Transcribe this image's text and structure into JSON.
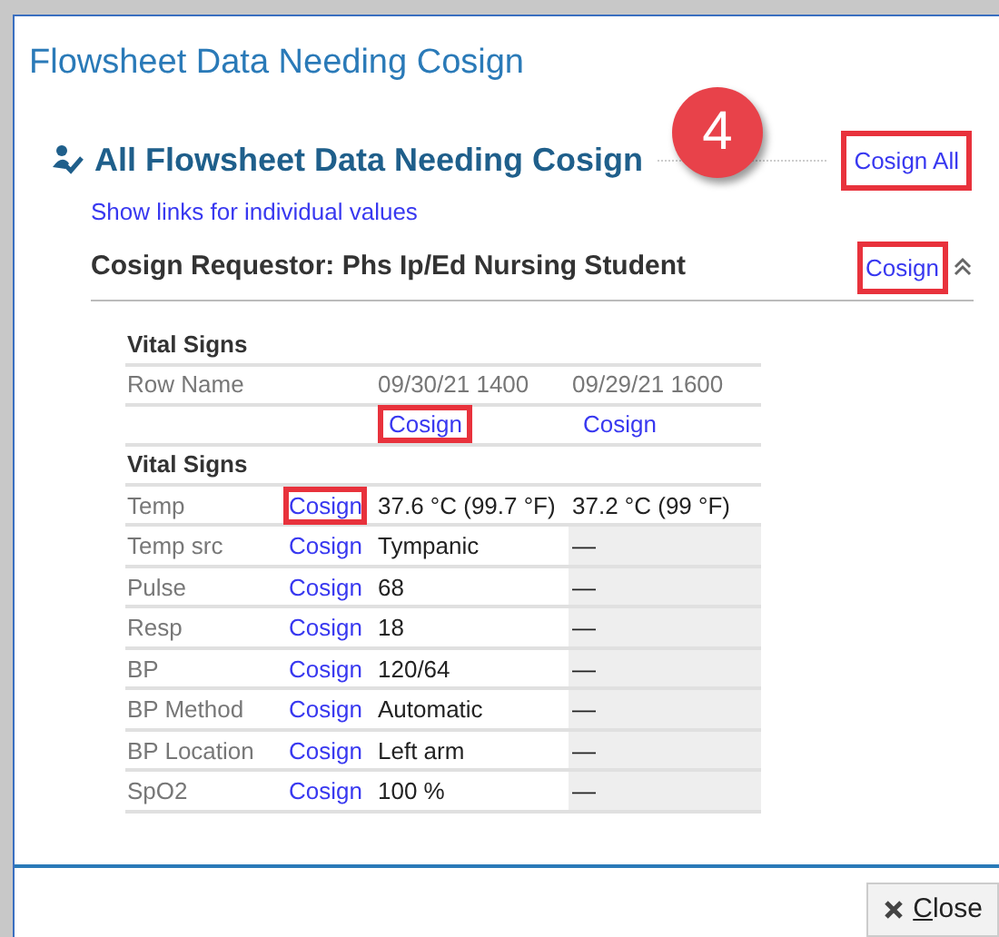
{
  "window": {
    "title": "Flowsheet Data Needing Cosign"
  },
  "section": {
    "title": "All Flowsheet Data Needing Cosign",
    "cosign_all": {
      "label": "Cosign All",
      "highlighted": true
    },
    "badge": "4"
  },
  "show_links": "Show links for individual values",
  "requestor": {
    "label": "Cosign Requestor: Phs Ip/Ed Nursing Student",
    "cosign": {
      "label": "Cosign",
      "highlighted": true
    },
    "expanded": true
  },
  "table": {
    "group": "Vital Signs",
    "header": {
      "label": "Row Name",
      "columns": [
        "09/30/21 1400",
        "09/29/21 1600"
      ]
    },
    "column_links": [
      {
        "label": "Cosign",
        "highlighted": true
      },
      {
        "label": "Cosign",
        "highlighted": false
      }
    ],
    "section": "Vital Signs",
    "rows": [
      {
        "name": "Temp",
        "link": {
          "label": "Cosign",
          "highlighted": true
        },
        "values": [
          "37.6 °C (99.7 °F)",
          "37.2 °C (99 °F)"
        ],
        "shaded": false
      },
      {
        "name": "Temp src",
        "link": {
          "label": "Cosign",
          "highlighted": false
        },
        "values": [
          "Tympanic",
          "—"
        ],
        "shaded": true
      },
      {
        "name": "Pulse",
        "link": {
          "label": "Cosign",
          "highlighted": false
        },
        "values": [
          "68",
          "—"
        ],
        "shaded": true
      },
      {
        "name": "Resp",
        "link": {
          "label": "Cosign",
          "highlighted": false
        },
        "values": [
          "18",
          "—"
        ],
        "shaded": true
      },
      {
        "name": "BP",
        "link": {
          "label": "Cosign",
          "highlighted": false
        },
        "values": [
          "120/64",
          "—"
        ],
        "shaded": true
      },
      {
        "name": "BP Method",
        "link": {
          "label": "Cosign",
          "highlighted": false
        },
        "values": [
          "Automatic",
          "—"
        ],
        "shaded": true
      },
      {
        "name": "BP Location",
        "link": {
          "label": "Cosign",
          "highlighted": false
        },
        "values": [
          "Left arm",
          "—"
        ],
        "shaded": true
      },
      {
        "name": "SpO2",
        "link": {
          "label": "Cosign",
          "highlighted": false
        },
        "values": [
          "100 %",
          "—"
        ],
        "shaded": true
      }
    ]
  },
  "footer": {
    "close": {
      "label": "Close"
    }
  }
}
